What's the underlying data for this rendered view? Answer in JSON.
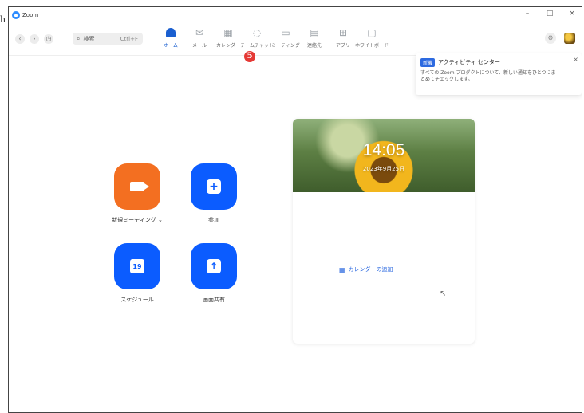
{
  "page_marker": "h",
  "window": {
    "title": "Zoom",
    "controls": {
      "minimize": "–",
      "maximize": "□",
      "close": "×"
    }
  },
  "toolbar": {
    "search": {
      "label": "検索",
      "shortcut": "Ctrl+F"
    },
    "tabs": [
      {
        "label": "ホーム",
        "icon": "home-icon",
        "active": true
      },
      {
        "label": "メール",
        "icon": "mail-icon",
        "active": false
      },
      {
        "label": "カレンダー",
        "icon": "calendar-icon",
        "active": false
      },
      {
        "label": "チームチャット",
        "icon": "chat-icon",
        "active": false
      },
      {
        "label": "ミーティング",
        "icon": "meeting-icon",
        "active": false
      },
      {
        "label": "連絡先",
        "icon": "contacts-icon",
        "active": false
      },
      {
        "label": "アプリ",
        "icon": "apps-icon",
        "active": false
      },
      {
        "label": "ホワイトボード",
        "icon": "whiteboard-icon",
        "active": false
      }
    ]
  },
  "step_badge": "5",
  "activity_center": {
    "badge": "新機",
    "title": "アクティビティ センター",
    "description": "すべての Zoom プロダクトについて、新しい通知をひとつにまとめてチェックします。",
    "close": "×"
  },
  "actions": [
    {
      "label": "新規ミーティング ⌄",
      "icon": "video-camera-icon",
      "color": "#f36f21"
    },
    {
      "label": "参加",
      "icon": "plus-icon",
      "color": "#0b5cff"
    },
    {
      "label": "スケジュール",
      "icon": "calendar-19-icon",
      "color": "#0b5cff"
    },
    {
      "label": "画面共有",
      "icon": "share-screen-icon",
      "color": "#0b5cff"
    }
  ],
  "calendar": {
    "time": "14:05",
    "date": "2023年9月25日",
    "add_calendar": "カレンダーの追加"
  }
}
